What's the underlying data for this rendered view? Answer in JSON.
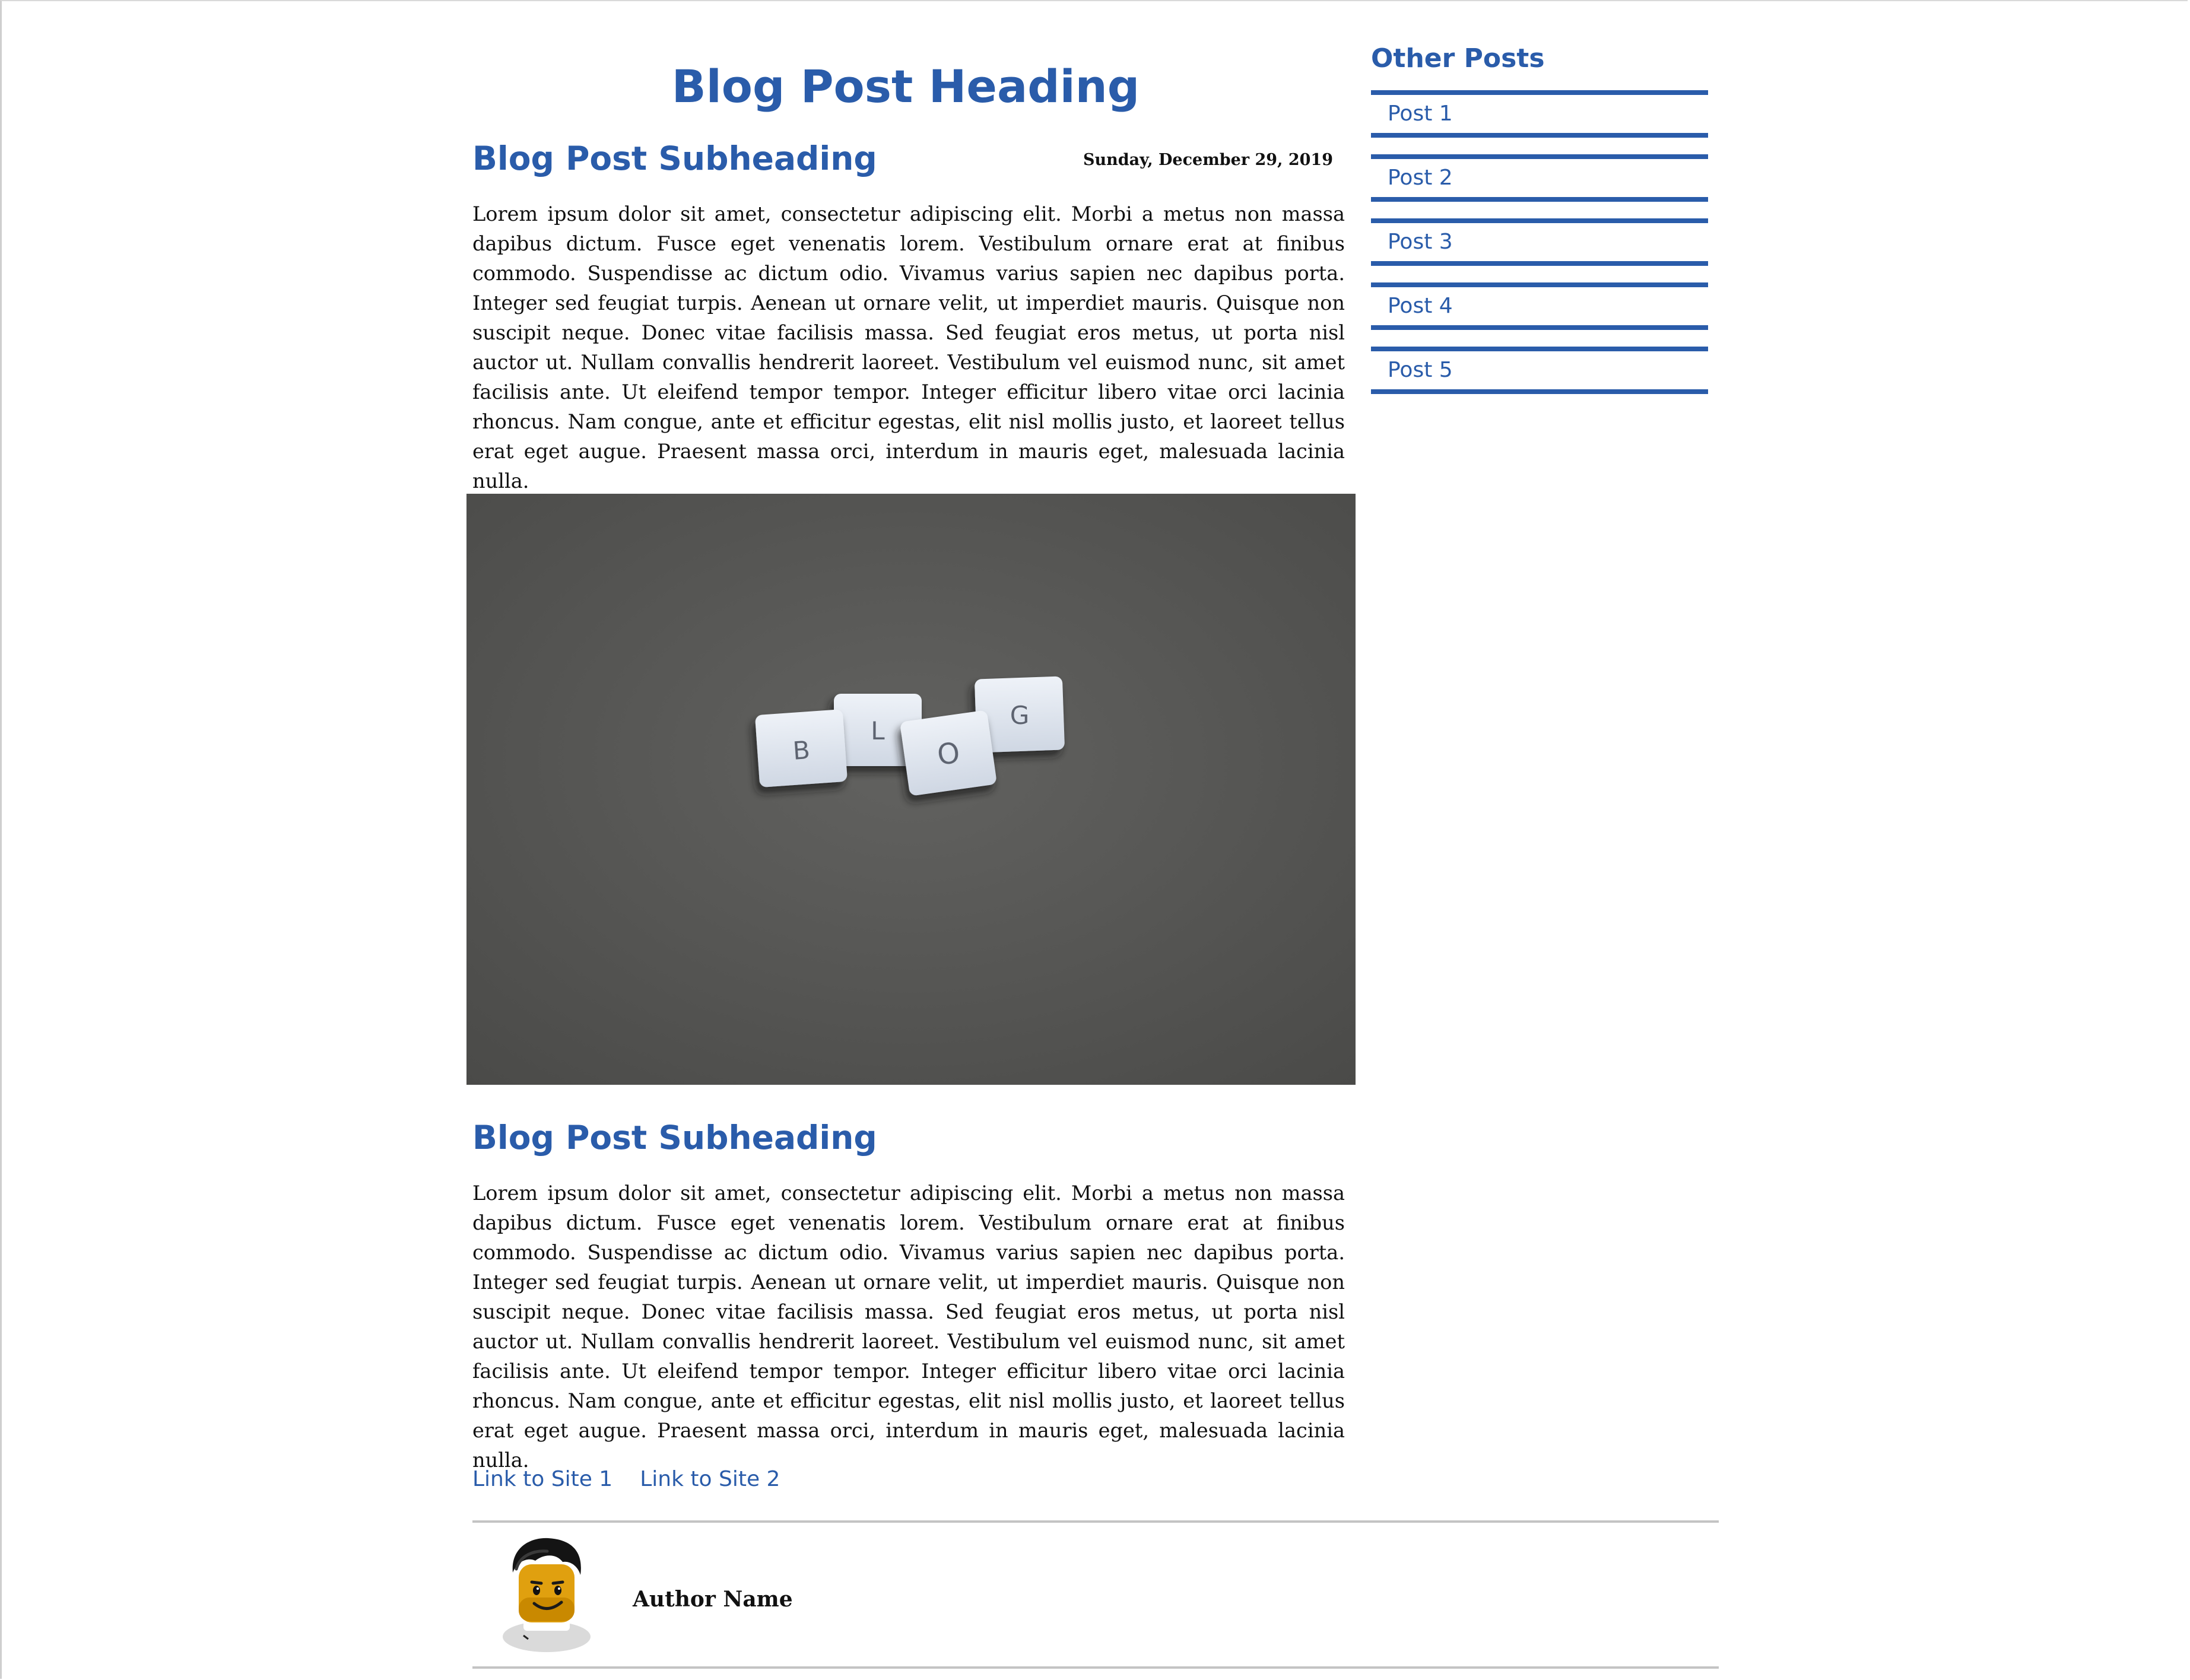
{
  "post": {
    "title": "Blog Post Heading",
    "date": "Sunday, December 29, 2019",
    "sections": [
      {
        "subheading": "Blog Post Subheading",
        "body": "Lorem ipsum dolor sit amet, consectetur adipiscing elit. Morbi a metus non massa dapibus dictum. Fusce eget venenatis lorem. Vestibulum ornare erat at finibus commodo. Suspendisse ac dictum odio. Vivamus varius sapien nec dapibus porta. Integer sed feugiat turpis. Aenean ut ornare velit, ut imperdiet mauris. Quisque non suscipit neque. Donec vitae facilisis massa. Sed feugiat eros metus, ut porta nisl auctor ut. Nullam convallis hendrerit laoreet. Vestibulum vel euismod nunc, sit amet facilisis ante. Ut eleifend tempor tempor. Integer efficitur libero vitae orci lacinia rhoncus. Nam congue, ante et efficitur egestas, elit nisl mollis justo, et laoreet tellus erat eget augue. Praesent massa orci, interdum in mauris eget, malesuada lacinia nulla."
      },
      {
        "subheading": "Blog Post Subheading",
        "body": "Lorem ipsum dolor sit amet, consectetur adipiscing elit. Morbi a metus non massa dapibus dictum. Fusce eget venenatis lorem. Vestibulum ornare erat at finibus commodo. Suspendisse ac dictum odio. Vivamus varius sapien nec dapibus porta. Integer sed feugiat turpis. Aenean ut ornare velit, ut imperdiet mauris. Quisque non suscipit neque. Donec vitae facilisis massa. Sed feugiat eros metus, ut porta nisl auctor ut. Nullam convallis hendrerit laoreet. Vestibulum vel euismod nunc, sit amet facilisis ante. Ut eleifend tempor tempor. Integer efficitur libero vitae orci lacinia rhoncus. Nam congue, ante et efficitur egestas, elit nisl mollis justo, et laoreet tellus erat eget augue. Praesent massa orci, interdum in mauris eget, malesuada lacinia nulla."
      }
    ],
    "image": {
      "tiles": [
        "B",
        "L",
        "O",
        "G"
      ],
      "background_color": "#5b5b59",
      "tile_color": "#e6ebf2"
    },
    "links": [
      {
        "label": "Link to Site 1"
      },
      {
        "label": "Link to Site 2"
      }
    ],
    "author": {
      "name": "Author Name",
      "avatar_icon": "lego-minifigure-avatar"
    }
  },
  "sidebar": {
    "title": "Other Posts",
    "items": [
      {
        "label": "Post 1"
      },
      {
        "label": "Post 2"
      },
      {
        "label": "Post 3"
      },
      {
        "label": "Post 4"
      },
      {
        "label": "Post 5"
      }
    ]
  },
  "theme": {
    "accent": "#2a5caa",
    "text": "#111111",
    "divider": "#c4c4c4",
    "background": "#ffffff"
  }
}
